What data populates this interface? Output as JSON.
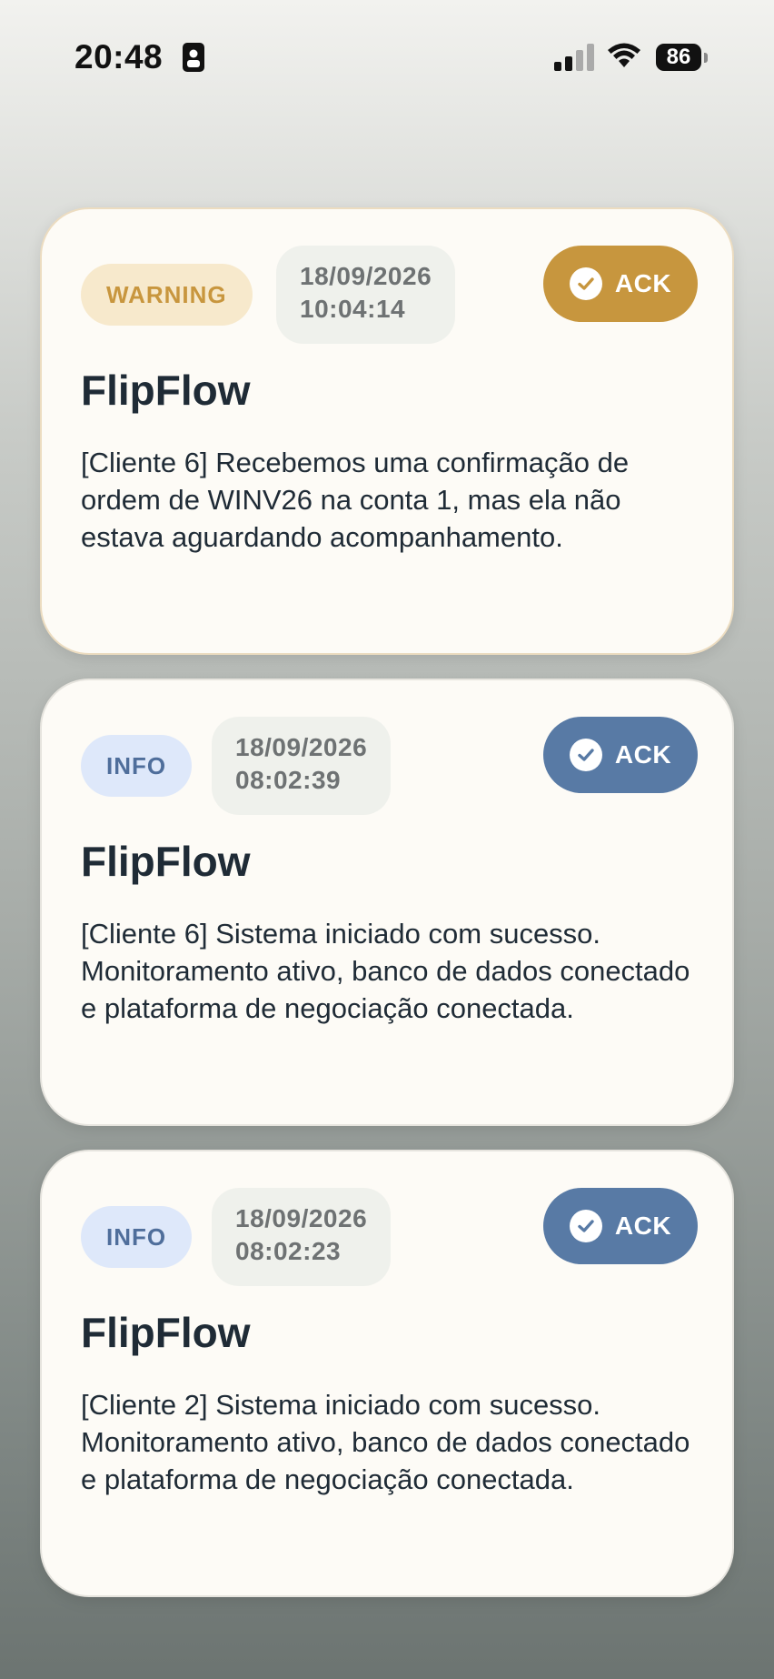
{
  "status_bar": {
    "time": "20:48",
    "battery": "86"
  },
  "colors": {
    "warning_accent": "#c7963e",
    "info_accent": "#587aa5",
    "card_bg": "#fdfbf6"
  },
  "notifications": [
    {
      "level": "WARNING",
      "date": "18/09/2026",
      "time": "10:04:14",
      "ack_label": "ACK",
      "title": "FlipFlow",
      "message": "[Cliente 6] Recebemos uma confirmação de ordem de WINV26 na conta 1, mas ela não estava aguardando acompanhamento."
    },
    {
      "level": "INFO",
      "date": "18/09/2026",
      "time": "08:02:39",
      "ack_label": "ACK",
      "title": "FlipFlow",
      "message": "[Cliente 6] Sistema iniciado com sucesso. Monitoramento ativo, banco de dados conectado e plataforma de negociação conectada."
    },
    {
      "level": "INFO",
      "date": "18/09/2026",
      "time": "08:02:23",
      "ack_label": "ACK",
      "title": "FlipFlow",
      "message": "[Cliente 2] Sistema iniciado com sucesso. Monitoramento ativo, banco de dados conectado e plataforma de negociação conectada."
    }
  ]
}
